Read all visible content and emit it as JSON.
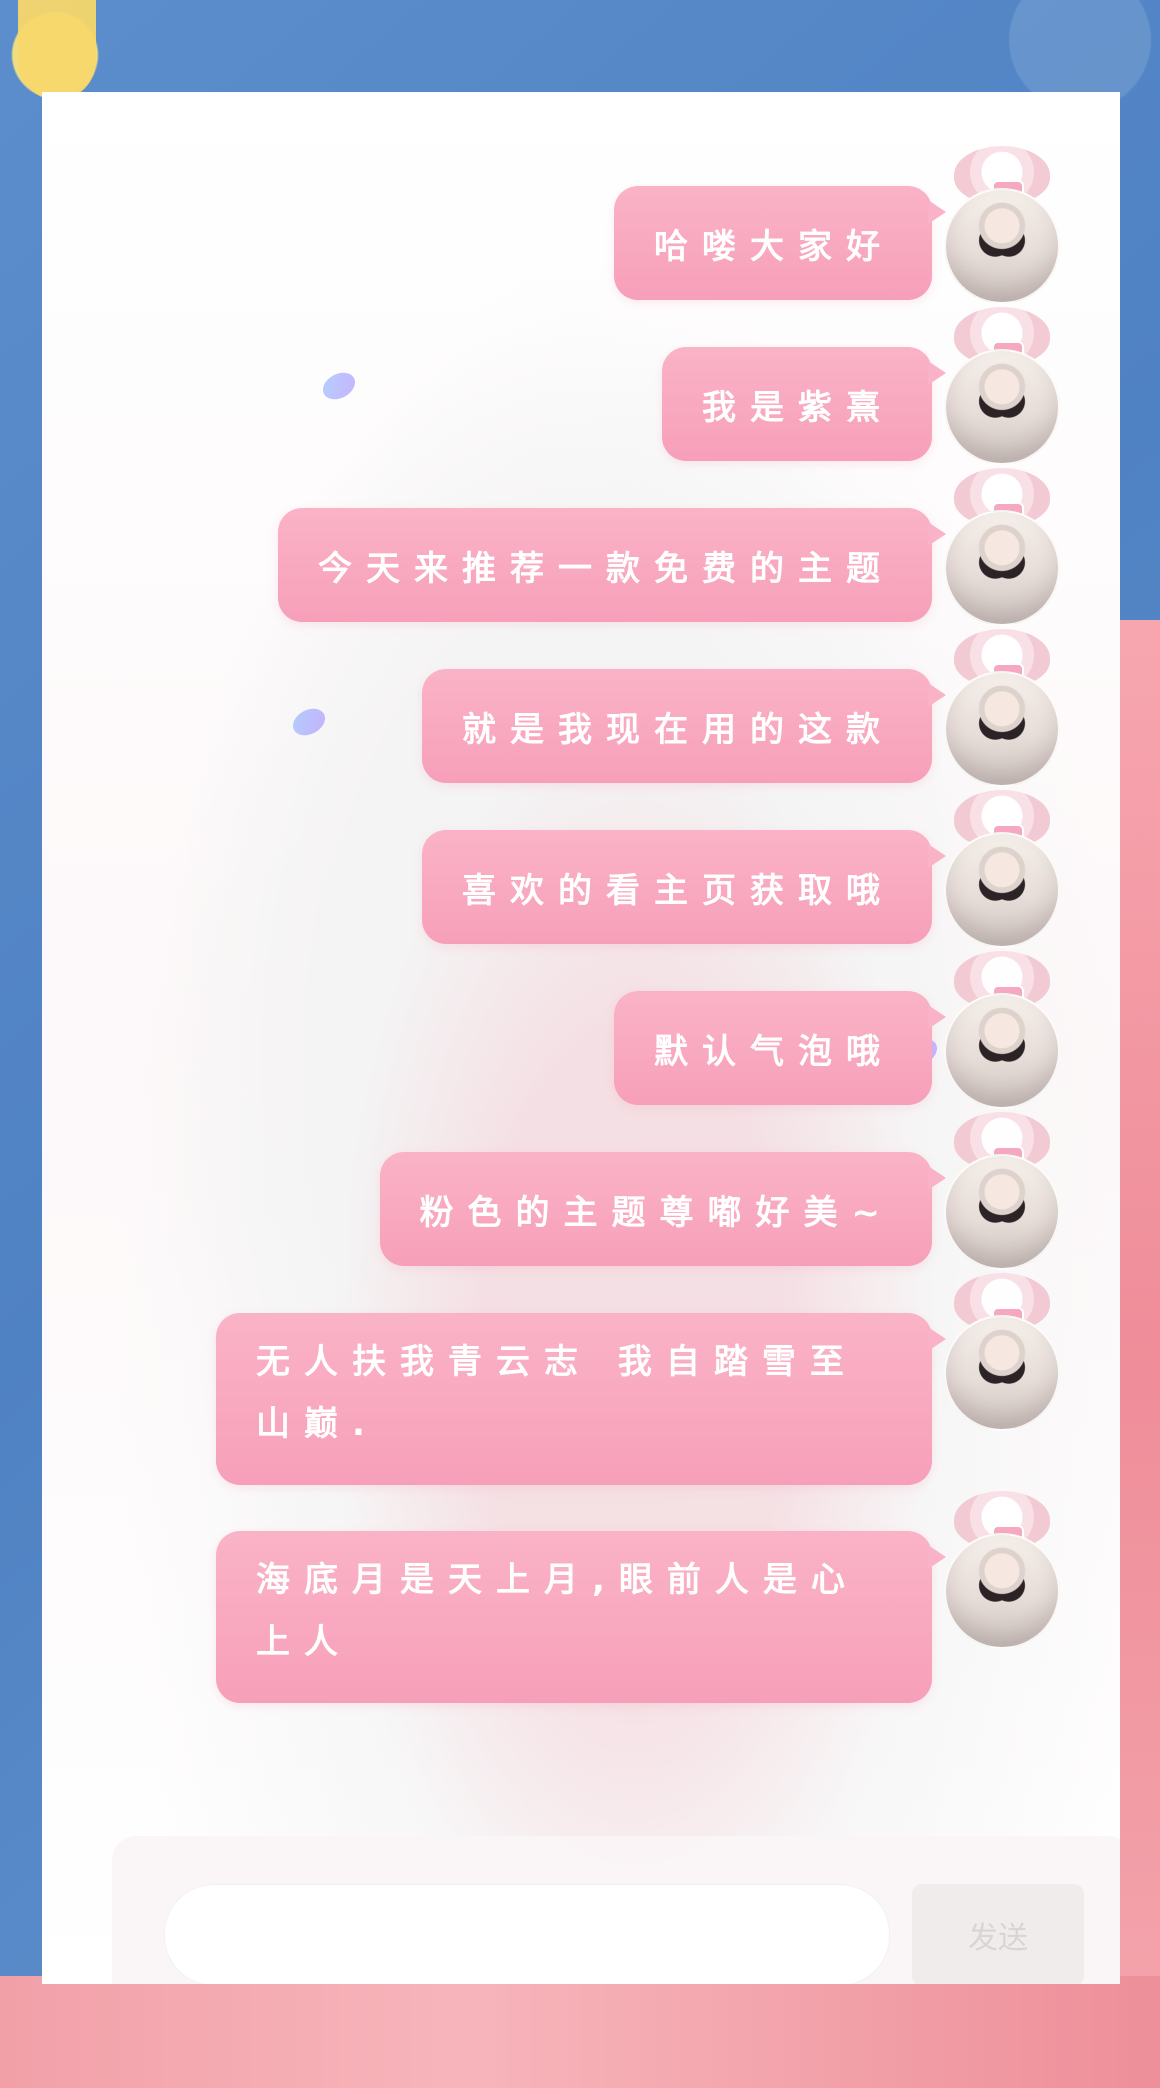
{
  "messages": [
    {
      "text": "哈喽大家好"
    },
    {
      "text": "我是紫熹"
    },
    {
      "text": "今天来推荐一款免费的主题"
    },
    {
      "text": "就是我现在用的这款"
    },
    {
      "text": "喜欢的看主页获取哦"
    },
    {
      "text": "默认气泡哦"
    },
    {
      "text": "粉色的主题尊嘟好美~"
    },
    {
      "text": "无人扶我青云志 我自踏雪至山巅."
    },
    {
      "text": "海底月是天上月,眼前人是心上人"
    }
  ],
  "input": {
    "placeholder": "",
    "send_label": "发送"
  },
  "tools": [
    {
      "icon": "mic-icon"
    },
    {
      "icon": "image-icon"
    },
    {
      "icon": "camera-icon"
    },
    {
      "icon": "envelope-icon"
    },
    {
      "icon": "emoji-icon"
    },
    {
      "icon": "plus-icon"
    }
  ],
  "colors": {
    "bubble": "#f79fba",
    "bubble_text": "#ffffff",
    "background_blue": "#5a8ac9",
    "background_pink": "#f2a0a8"
  }
}
